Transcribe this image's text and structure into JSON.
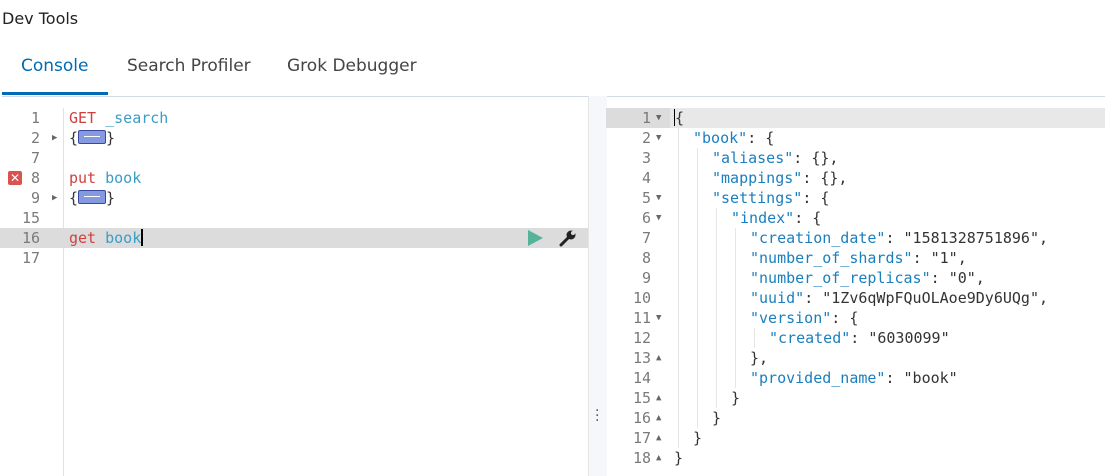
{
  "app": {
    "title": "Dev Tools"
  },
  "tabs": [
    {
      "label": "Console",
      "active": true
    },
    {
      "label": "Search Profiler",
      "active": false
    },
    {
      "label": "Grok Debugger",
      "active": false
    }
  ],
  "editor": {
    "lines": [
      {
        "num": "1",
        "method": "GET",
        "path": "_search"
      },
      {
        "num": "2",
        "fold": "collapsed",
        "open": "{",
        "close": "}"
      },
      {
        "num": "7"
      },
      {
        "num": "8",
        "method": "put",
        "path": "book",
        "error": true
      },
      {
        "num": "9",
        "fold": "collapsed",
        "open": "{",
        "close": "}"
      },
      {
        "num": "15"
      },
      {
        "num": "16",
        "method": "get",
        "path": "book",
        "active": true
      },
      {
        "num": "17"
      }
    ],
    "actions": {
      "run_icon": "play-icon",
      "settings_icon": "wrench-icon"
    }
  },
  "output": {
    "lines": [
      {
        "num": "1",
        "text": "{"
      },
      {
        "num": "2",
        "key": "\"book\"",
        "rest": ": {"
      },
      {
        "num": "3",
        "key": "\"aliases\"",
        "rest": ": {},"
      },
      {
        "num": "4",
        "key": "\"mappings\"",
        "rest": ": {},"
      },
      {
        "num": "5",
        "key": "\"settings\"",
        "rest": ": {"
      },
      {
        "num": "6",
        "key": "\"index\"",
        "rest": ": {"
      },
      {
        "num": "7",
        "key": "\"creation_date\"",
        "rest": ": ",
        "value": "\"1581328751896\"",
        "tail": ","
      },
      {
        "num": "8",
        "key": "\"number_of_shards\"",
        "rest": ": ",
        "value": "\"1\"",
        "tail": ","
      },
      {
        "num": "9",
        "key": "\"number_of_replicas\"",
        "rest": ": ",
        "value": "\"0\"",
        "tail": ","
      },
      {
        "num": "10",
        "key": "\"uuid\"",
        "rest": ": ",
        "value": "\"1Zv6qWpFQuOLAoe9Dy6UQg\"",
        "tail": ","
      },
      {
        "num": "11",
        "key": "\"version\"",
        "rest": ": {"
      },
      {
        "num": "12",
        "key": "\"created\"",
        "rest": ": ",
        "value": "\"6030099\"",
        "tail": ""
      },
      {
        "num": "13",
        "text": "},"
      },
      {
        "num": "14",
        "key": "\"provided_name\"",
        "rest": ": ",
        "value": "\"book\"",
        "tail": ""
      },
      {
        "num": "15",
        "text": "}"
      },
      {
        "num": "16",
        "text": "}"
      },
      {
        "num": "17",
        "text": "}"
      },
      {
        "num": "18",
        "text": "}"
      }
    ]
  }
}
